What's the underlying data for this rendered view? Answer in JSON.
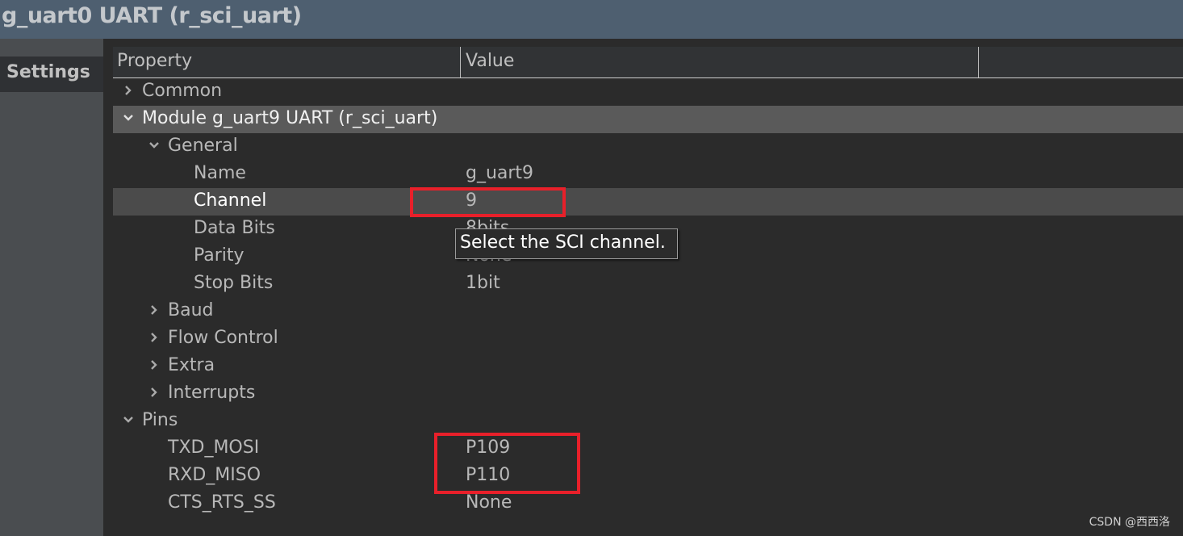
{
  "window": {
    "title": "g_uart0 UART (r_sci_uart)"
  },
  "sidebar": {
    "tabs": [
      {
        "label": "Settings"
      }
    ]
  },
  "table": {
    "headers": [
      "Property",
      "Value"
    ],
    "rows": [
      {
        "label": "Common",
        "value": "",
        "level": 0,
        "expander": "collapsed"
      },
      {
        "label": "Module g_uart9 UART (r_sci_uart)",
        "value": "",
        "level": 0,
        "expander": "expanded"
      },
      {
        "label": "General",
        "value": "",
        "level": 1,
        "expander": "expanded"
      },
      {
        "label": "Name",
        "value": "g_uart9",
        "level": 2
      },
      {
        "label": "Channel",
        "value": "9",
        "level": 2,
        "selected": true
      },
      {
        "label": "Data Bits",
        "value": "8bits",
        "level": 2
      },
      {
        "label": "Parity",
        "value": "None",
        "level": 2
      },
      {
        "label": "Stop Bits",
        "value": "1bit",
        "level": 2
      },
      {
        "label": "Baud",
        "value": "",
        "level": 1,
        "expander": "collapsed"
      },
      {
        "label": "Flow Control",
        "value": "",
        "level": 1,
        "expander": "collapsed"
      },
      {
        "label": "Extra",
        "value": "",
        "level": 1,
        "expander": "collapsed"
      },
      {
        "label": "Interrupts",
        "value": "",
        "level": 1,
        "expander": "collapsed"
      },
      {
        "label": "Pins",
        "value": "",
        "level": 0,
        "expander": "expanded"
      },
      {
        "label": "TXD_MOSI",
        "value": "P109",
        "level": 1
      },
      {
        "label": "RXD_MISO",
        "value": "P110",
        "level": 1
      },
      {
        "label": "CTS_RTS_SS",
        "value": "None",
        "level": 1
      }
    ]
  },
  "tooltip": {
    "text": "Select the SCI channel."
  },
  "watermark": "CSDN @西西洛",
  "colors": {
    "highlight": "#e8202a",
    "titlebar": "#4e5f70"
  }
}
